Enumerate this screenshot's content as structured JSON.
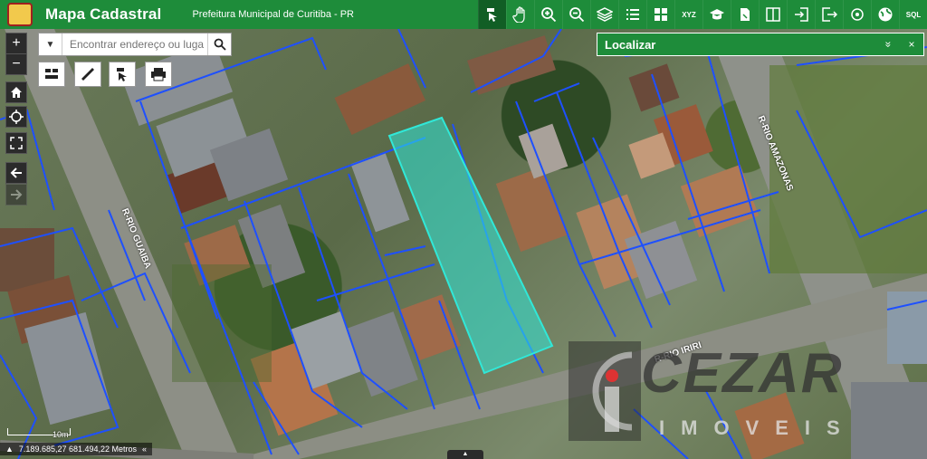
{
  "header": {
    "app_title": "Mapa Cadastral",
    "subtitle": "Prefeitura Municipal de Curitiba - PR",
    "toolbar": [
      {
        "icon": "identify-icon",
        "active": true
      },
      {
        "icon": "pan-hand-icon"
      },
      {
        "icon": "zoom-in-icon"
      },
      {
        "icon": "zoom-out-icon"
      },
      {
        "icon": "layers-icon"
      },
      {
        "icon": "list-icon"
      },
      {
        "icon": "grid-icon"
      },
      {
        "icon": "xyz-coordinates-icon",
        "label": "XYZ"
      },
      {
        "icon": "education-icon"
      },
      {
        "icon": "document-edit-icon"
      },
      {
        "icon": "split-view-icon"
      },
      {
        "icon": "import-icon"
      },
      {
        "icon": "export-icon"
      },
      {
        "icon": "target-icon"
      },
      {
        "icon": "globe-icon"
      },
      {
        "icon": "sql-query-icon",
        "label": "SQL"
      }
    ]
  },
  "search": {
    "placeholder": "Encontrar endereço ou luga"
  },
  "panel": {
    "title": "Localizar",
    "collapse_icon": "double-chevron-down-icon",
    "close_icon": "close-icon",
    "collapse_glyph": "»",
    "close_glyph": "×"
  },
  "map": {
    "streets": [
      {
        "name": "R-RIO GUAIBA"
      },
      {
        "name": "R-RIO AMAZONAS"
      },
      {
        "name": "R-RIO IRIRI"
      }
    ],
    "scale_label": "10m",
    "coords": "7.189.685,27 681.494,22 Metros",
    "highlight_color": "#30e8d8",
    "parcel_color": "#1e50ff"
  },
  "watermark": {
    "title": "CEZAR",
    "subtitle": "IMOVEIS"
  },
  "controls": {
    "zoom_in": "+",
    "zoom_out": "−",
    "home_icon": "home-icon",
    "locate_icon": "crosshair-icon",
    "fullscreen_icon": "fullscreen-icon",
    "back_icon": "arrow-left-icon",
    "forward_icon": "arrow-right-icon"
  }
}
